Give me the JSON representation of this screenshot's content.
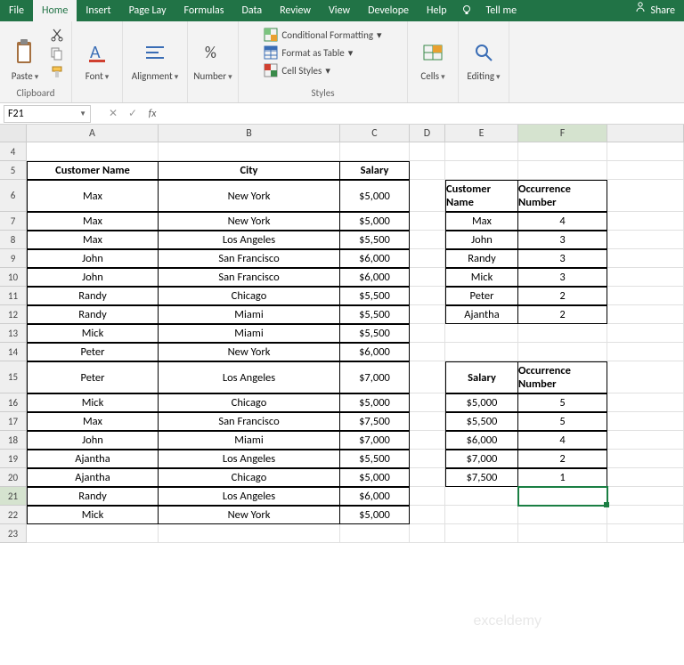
{
  "menu": {
    "file": "File",
    "home": "Home",
    "insert": "Insert",
    "pagelayout": "Page Lay",
    "formulas": "Formulas",
    "data": "Data",
    "review": "Review",
    "view": "View",
    "developer": "Develope",
    "help": "Help",
    "tellme": "Tell me",
    "share": "Share"
  },
  "ribbon": {
    "clipboard": {
      "paste": "Paste",
      "label": "Clipboard"
    },
    "font": {
      "btn": "Font",
      "label": ""
    },
    "alignment": {
      "btn": "Alignment",
      "label": ""
    },
    "number": {
      "btn": "Number",
      "label": ""
    },
    "styles": {
      "cond": "Conditional Formatting",
      "table": "Format as Table",
      "cell": "Cell Styles",
      "label": "Styles"
    },
    "cells": {
      "btn": "Cells",
      "label": ""
    },
    "editing": {
      "btn": "Editing",
      "label": ""
    }
  },
  "namebox": "F21",
  "cols": [
    "A",
    "B",
    "C",
    "D",
    "E",
    "F"
  ],
  "main": {
    "headers": {
      "name": "Customer Name",
      "city": "City",
      "salary": "Salary"
    },
    "rows": [
      {
        "n": "Max",
        "c": "New York",
        "s": "$5,000"
      },
      {
        "n": "Max",
        "c": "New York",
        "s": "$5,000"
      },
      {
        "n": "Max",
        "c": "Los Angeles",
        "s": "$5,500"
      },
      {
        "n": "John",
        "c": "San Francisco",
        "s": "$6,000"
      },
      {
        "n": "John",
        "c": "San Francisco",
        "s": "$6,000"
      },
      {
        "n": "Randy",
        "c": "Chicago",
        "s": "$5,500"
      },
      {
        "n": "Randy",
        "c": "Miami",
        "s": "$5,500"
      },
      {
        "n": "Mick",
        "c": "Miami",
        "s": "$5,500"
      },
      {
        "n": "Peter",
        "c": "New York",
        "s": "$6,000"
      },
      {
        "n": "Peter",
        "c": "Los Angeles",
        "s": "$7,000"
      },
      {
        "n": "Mick",
        "c": "Chicago",
        "s": "$5,000"
      },
      {
        "n": "Max",
        "c": "San Francisco",
        "s": "$7,500"
      },
      {
        "n": "John",
        "c": "Miami",
        "s": "$7,000"
      },
      {
        "n": "Ajantha",
        "c": "Los Angeles",
        "s": "$5,500"
      },
      {
        "n": "Ajantha",
        "c": "Chicago",
        "s": "$5,000"
      },
      {
        "n": "Randy",
        "c": "Los Angeles",
        "s": "$6,000"
      },
      {
        "n": "Mick",
        "c": "New York",
        "s": "$5,000"
      }
    ]
  },
  "side1": {
    "headers": {
      "name": "Customer Name",
      "occ": "Occurrence Number"
    },
    "rows": [
      {
        "n": "Max",
        "o": "4"
      },
      {
        "n": "John",
        "o": "3"
      },
      {
        "n": "Randy",
        "o": "3"
      },
      {
        "n": "Mick",
        "o": "3"
      },
      {
        "n": "Peter",
        "o": "2"
      },
      {
        "n": "Ajantha",
        "o": "2"
      }
    ]
  },
  "side2": {
    "headers": {
      "sal": "Salary",
      "occ": "Occurrence Number"
    },
    "rows": [
      {
        "s": "$5,000",
        "o": "5"
      },
      {
        "s": "$5,500",
        "o": "5"
      },
      {
        "s": "$6,000",
        "o": "4"
      },
      {
        "s": "$7,000",
        "o": "2"
      },
      {
        "s": "$7,500",
        "o": "1"
      }
    ]
  },
  "watermark": "exceldemy"
}
